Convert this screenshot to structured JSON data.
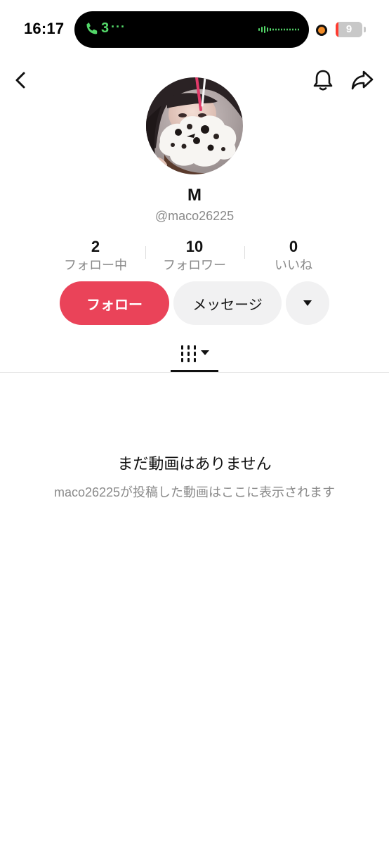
{
  "status_bar": {
    "time": "16:17",
    "call_count": "3",
    "call_dots": "···",
    "battery_level": "9",
    "battery_fraction": 0.09,
    "call_color": "#53d769",
    "privacy_indicator_color": "#f28c28",
    "battery_low_color": "#ff3b30"
  },
  "header": {
    "back_icon": "chevron-left-icon",
    "bell_icon": "bell-icon",
    "share_icon": "share-arrow-icon"
  },
  "profile": {
    "display_name": "M",
    "username": "@maco26225",
    "avatar": "profile-photo"
  },
  "stats": {
    "following": {
      "value": "2",
      "label": "フォロー中"
    },
    "followers": {
      "value": "10",
      "label": "フォロワー"
    },
    "likes": {
      "value": "0",
      "label": "いいね"
    }
  },
  "actions": {
    "follow_label": "フォロー",
    "message_label": "メッセージ",
    "more_icon": "caret-down-icon",
    "follow_color": "#ea4359"
  },
  "tabs": {
    "videos_icon": "grid-lines-icon",
    "dropdown_icon": "caret-down-icon"
  },
  "empty_state": {
    "title": "まだ動画はありません",
    "subtitle": "maco26225が投稿した動画はここに表示されます"
  }
}
